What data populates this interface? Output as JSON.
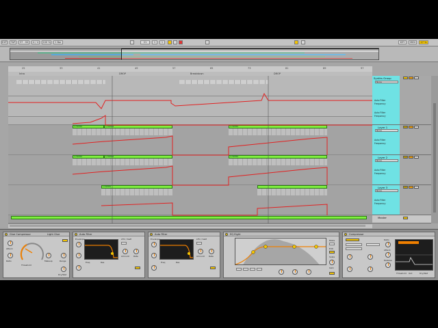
{
  "control_bar": {
    "items": [
      "EXT",
      "TAP",
      "37 . 00",
      "4 / 4",
      "100 %",
      "1 Bar",
      "21",
      "1",
      "1",
      "KEY",
      "MIDI",
      "27 %"
    ]
  },
  "ruler": {
    "markers": [
      "Intro",
      "DROP",
      "Breakdown",
      "DROP"
    ],
    "bars": [
      "25",
      "33",
      "41",
      "49",
      "57",
      "65",
      "73",
      "81",
      "89",
      "97"
    ]
  },
  "arrangement": {
    "clip_names": [
      "Chords",
      "Chords",
      "Chords",
      "Chords",
      "Chords",
      "Chords",
      "Chords"
    ]
  },
  "tracks": {
    "group": {
      "name": "Synths Group",
      "selector": "None",
      "device_param_1": "Auto Filter",
      "device_param_2": "Frequency",
      "device_param_3": "Auto Filter",
      "device_param_4": "Frequency"
    },
    "layer1": {
      "name": "Layer 1",
      "selector": "None",
      "num": "13",
      "p1": "Auto Filter",
      "p2": "Frequency"
    },
    "layer2": {
      "name": "Layer 2",
      "selector": "None",
      "num": "14",
      "p1": "Auto Filter",
      "p2": "Frequency"
    },
    "layer3": {
      "name": "Layer 3",
      "selector": "None",
      "num": "15",
      "p1": "Auto Filter",
      "p2": "Frequency"
    },
    "master": {
      "name": "Master",
      "selector": "None"
    }
  },
  "devices": {
    "glue": {
      "title": "Glue Compressor",
      "preset": "Light Glue",
      "labels": [
        "Attack",
        "Ratio",
        "Threshold",
        "Makeup",
        "Range",
        "Dry/Wet"
      ]
    },
    "autofilter1": {
      "title": "Auto Filter",
      "labels": [
        "Envelope",
        "LFO / S&H",
        "Freq",
        "Res",
        "Amount",
        "Rate"
      ]
    },
    "autofilter2": {
      "title": "Auto Filter",
      "labels": [
        "Envelope",
        "LFO / S&H",
        "Freq",
        "Res",
        "Amount",
        "Rate"
      ]
    },
    "eq": {
      "title": "EQ Eight",
      "labels": [
        "Mode",
        "Edit",
        "Scale",
        "Gain",
        "Adapt. Q"
      ]
    },
    "compressor": {
      "title": "Compressor",
      "labels": [
        "Ratio",
        "Attack",
        "Release",
        "Threshold",
        "Out",
        "Knee",
        "Dry/Wet"
      ]
    }
  },
  "colors": {
    "accent": "#f3c400",
    "clip": "#7fef3f",
    "automation": "#e22020",
    "group": "#6fe2e4"
  }
}
